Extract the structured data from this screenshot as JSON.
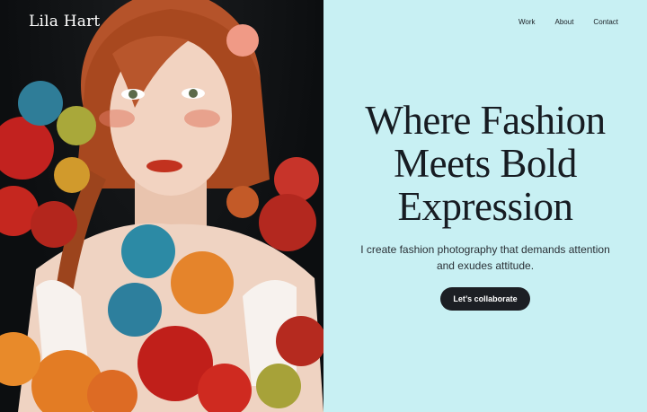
{
  "brand": {
    "name": "Lila Hart"
  },
  "nav": {
    "items": [
      {
        "label": "Work"
      },
      {
        "label": "About"
      },
      {
        "label": "Contact"
      }
    ]
  },
  "hero": {
    "headline_lines": [
      "Where Fashion",
      "Meets Bold",
      "Expression"
    ],
    "subtitle_lines": [
      "I create fashion photography that demands attention",
      "and exudes attitude."
    ],
    "cta_label": "Let’s collaborate"
  },
  "colors": {
    "panel_background": "#c8f0f3",
    "text_dark": "#171c22",
    "button_background": "#1c1f24",
    "photo_background": "#0c0e10"
  }
}
